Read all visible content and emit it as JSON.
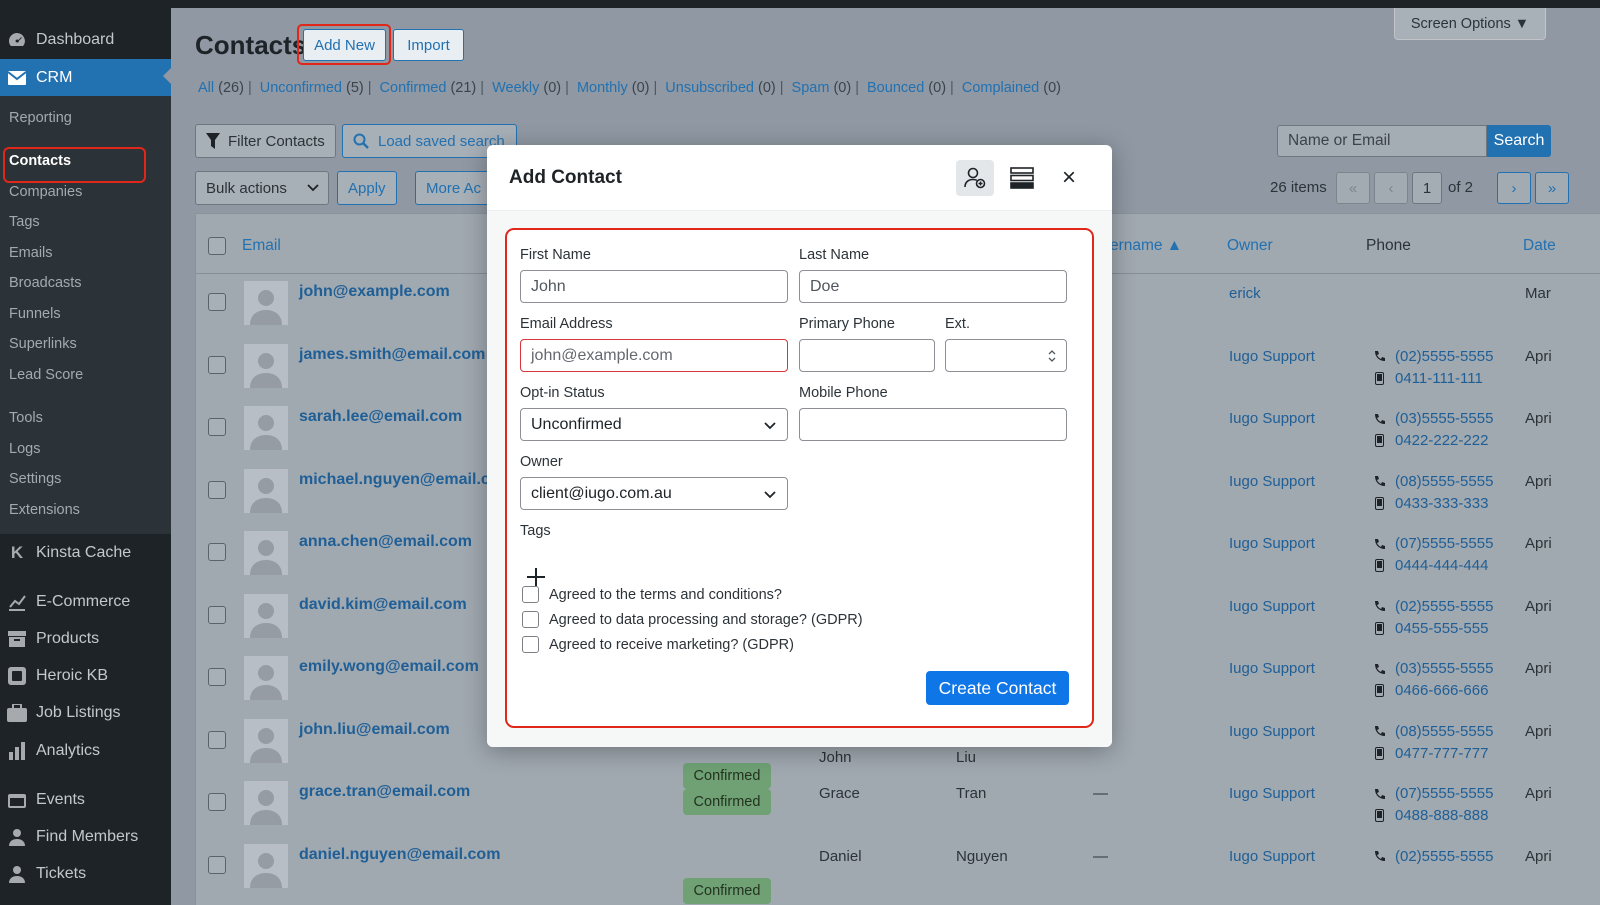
{
  "sidebar": {
    "items": [
      {
        "label": "Dashboard",
        "icon": "dashboard-icon"
      },
      {
        "label": "CRM",
        "icon": "mail-icon"
      },
      {
        "label": "Kinsta Cache",
        "icon": "kinsta-icon"
      },
      {
        "label": "E-Commerce",
        "icon": "chart-icon"
      },
      {
        "label": "Products",
        "icon": "archive-icon"
      },
      {
        "label": "Heroic KB",
        "icon": "kb-icon"
      },
      {
        "label": "Job Listings",
        "icon": "briefcase-icon"
      },
      {
        "label": "Analytics",
        "icon": "bar-chart-icon"
      },
      {
        "label": "Events",
        "icon": "calendar-icon"
      },
      {
        "label": "Find Members",
        "icon": "person-icon"
      },
      {
        "label": "Tickets",
        "icon": "tickets-icon"
      }
    ],
    "crm_submenu": [
      "Reporting",
      "Contacts",
      "Companies",
      "Tags",
      "Emails",
      "Broadcasts",
      "Funnels",
      "Superlinks",
      "Lead Score",
      "Tools",
      "Logs",
      "Settings",
      "Extensions"
    ]
  },
  "header": {
    "title": "Contacts",
    "add_new": "Add New",
    "import": "Import",
    "screen_options": "Screen Options ▼"
  },
  "filters": [
    {
      "label": "All",
      "count": "(26)"
    },
    {
      "label": "Unconfirmed",
      "count": "(5)"
    },
    {
      "label": "Confirmed",
      "count": "(21)"
    },
    {
      "label": "Weekly",
      "count": "(0)"
    },
    {
      "label": "Monthly",
      "count": "(0)"
    },
    {
      "label": "Unsubscribed",
      "count": "(0)"
    },
    {
      "label": "Spam",
      "count": "(0)"
    },
    {
      "label": "Bounced",
      "count": "(0)"
    },
    {
      "label": "Complained",
      "count": "(0)"
    }
  ],
  "toolbar": {
    "filter_contacts": "Filter Contacts",
    "load_saved_search": "Load saved search",
    "bulk_actions": "Bulk actions",
    "apply": "Apply",
    "more_actions": "More Ac",
    "search_placeholder": "Name or Email",
    "search_button": "Search",
    "items": "26 items",
    "first": "«",
    "prev": "‹",
    "page": "1",
    "of": "of 2",
    "next": "›",
    "last": "»"
  },
  "table": {
    "headers": {
      "email": "Email",
      "username": "Username ▲",
      "owner": "Owner",
      "phone": "Phone",
      "date": "Date"
    },
    "rows": [
      {
        "email": "john@example.com",
        "status": "",
        "first": "",
        "last": "",
        "username": "—",
        "owner": "erick",
        "phone1": "",
        "phone2": "",
        "date": "Mar"
      },
      {
        "email": "james.smith@email.com",
        "status": "",
        "first": "",
        "last": "",
        "username": "—",
        "owner": "Iugo Support",
        "phone1": "(02)5555-5555",
        "phone2": "0411-111-111",
        "date": "Apri"
      },
      {
        "email": "sarah.lee@email.com",
        "status": "",
        "first": "",
        "last": "",
        "username": "—",
        "owner": "Iugo Support",
        "phone1": "(03)5555-5555",
        "phone2": "0422-222-222",
        "date": "Apri"
      },
      {
        "email": "michael.nguyen@email.c",
        "status": "",
        "first": "",
        "last": "",
        "username": "—",
        "owner": "Iugo Support",
        "phone1": "(08)5555-5555",
        "phone2": "0433-333-333",
        "date": "Apri"
      },
      {
        "email": "anna.chen@email.com",
        "status": "",
        "first": "",
        "last": "",
        "username": "—",
        "owner": "Iugo Support",
        "phone1": "(07)5555-5555",
        "phone2": "0444-444-444",
        "date": "Apri"
      },
      {
        "email": "david.kim@email.com",
        "status": "",
        "first": "",
        "last": "",
        "username": "—",
        "owner": "Iugo Support",
        "phone1": "(02)5555-5555",
        "phone2": "0455-555-555",
        "date": "Apri"
      },
      {
        "email": "emily.wong@email.com",
        "status": "",
        "first": "",
        "last": "",
        "username": "—",
        "owner": "Iugo Support",
        "phone1": "(03)5555-5555",
        "phone2": "0466-666-666",
        "date": "Apri"
      },
      {
        "email": "john.liu@email.com",
        "status": "Confirmed",
        "first": "John",
        "last": "Liu",
        "username": "—",
        "owner": "Iugo Support",
        "phone1": "(08)5555-5555",
        "phone2": "0477-777-777",
        "date": "Apri"
      },
      {
        "email": "grace.tran@email.com",
        "status": "Confirmed",
        "first": "Grace",
        "last": "Tran",
        "username": "—",
        "owner": "Iugo Support",
        "phone1": "(07)5555-5555",
        "phone2": "0488-888-888",
        "date": "Apri"
      },
      {
        "email": "daniel.nguyen@email.com",
        "status": "Confirmed",
        "first": "Daniel",
        "last": "Nguyen",
        "username": "—",
        "owner": "Iugo Support",
        "phone1": "(02)5555-5555",
        "phone2": "",
        "date": "Apri"
      }
    ]
  },
  "modal": {
    "title": "Add Contact",
    "close": "×",
    "first_name_label": "First Name",
    "first_name_placeholder": "John",
    "last_name_label": "Last Name",
    "last_name_placeholder": "Doe",
    "email_label": "Email Address",
    "email_placeholder": "john@example.com",
    "primary_phone_label": "Primary Phone",
    "ext_label": "Ext.",
    "optin_label": "Opt-in Status",
    "optin_value": "Unconfirmed",
    "mobile_label": "Mobile Phone",
    "owner_label": "Owner",
    "owner_value": "client@iugo.com.au",
    "tags_label": "Tags",
    "checkboxes": [
      "Agreed to the terms and conditions?",
      "Agreed to data processing and storage? (GDPR)",
      "Agreed to receive marketing? (GDPR)"
    ],
    "create_button": "Create Contact"
  },
  "colors": {
    "accent": "#2271b1",
    "sidebar": "#1e2327",
    "highlight": "#e0271a",
    "primary_button": "#0f76e8"
  }
}
